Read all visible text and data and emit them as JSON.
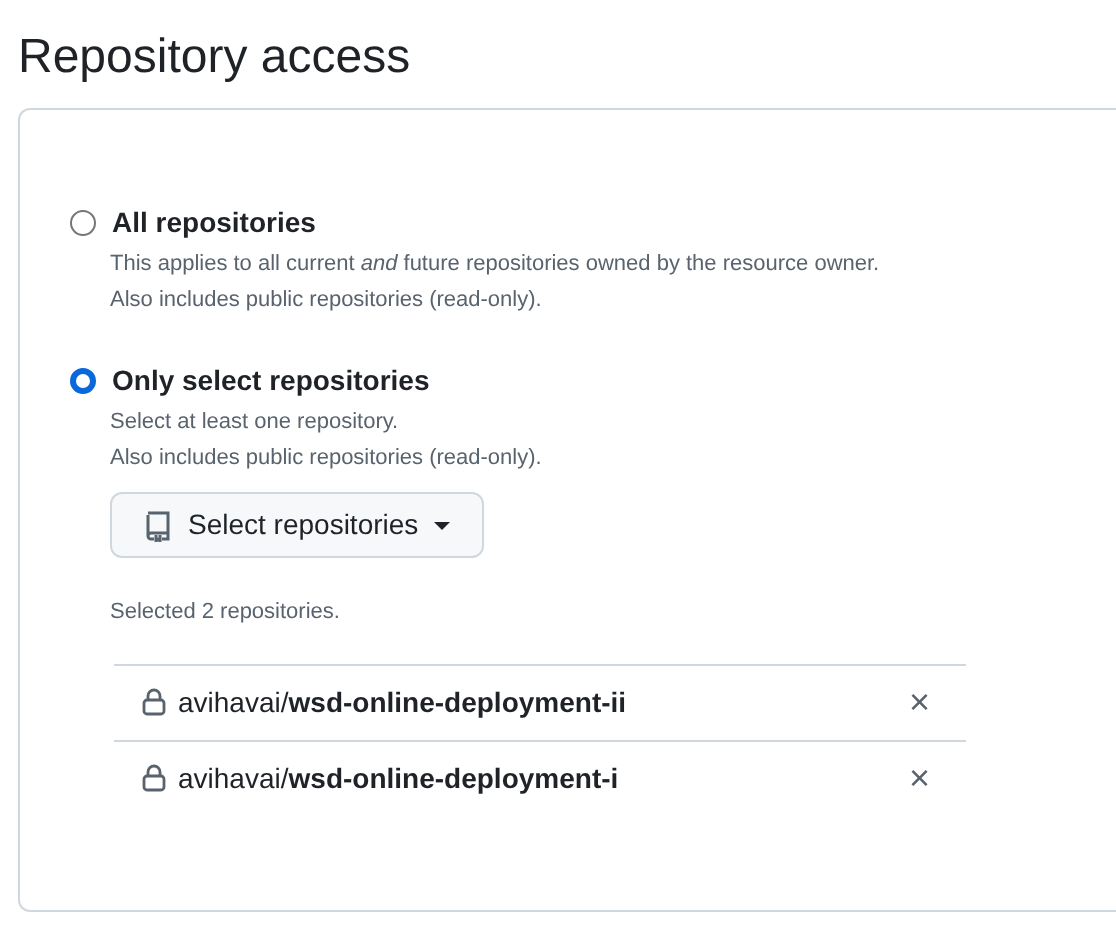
{
  "title": "Repository access",
  "options": [
    {
      "label": "All repositories",
      "selected": false,
      "descriptions": [
        "This applies to all current *and* future repositories owned by the resource owner.",
        "Also includes public repositories (read-only)."
      ]
    },
    {
      "label": "Only select repositories",
      "selected": true,
      "descriptions": [
        "Select at least one repository.",
        "Also includes public repositories (read-only)."
      ],
      "button": "Select repositories",
      "summary": "Selected 2 repositories.",
      "repositories": [
        {
          "name": "avihavai/**wsd-online-deployment-ii**",
          "remove": "×"
        },
        {
          "name": "avihavai/**wsd-online-deployment-i**",
          "remove": "×"
        }
      ]
    }
  ]
}
